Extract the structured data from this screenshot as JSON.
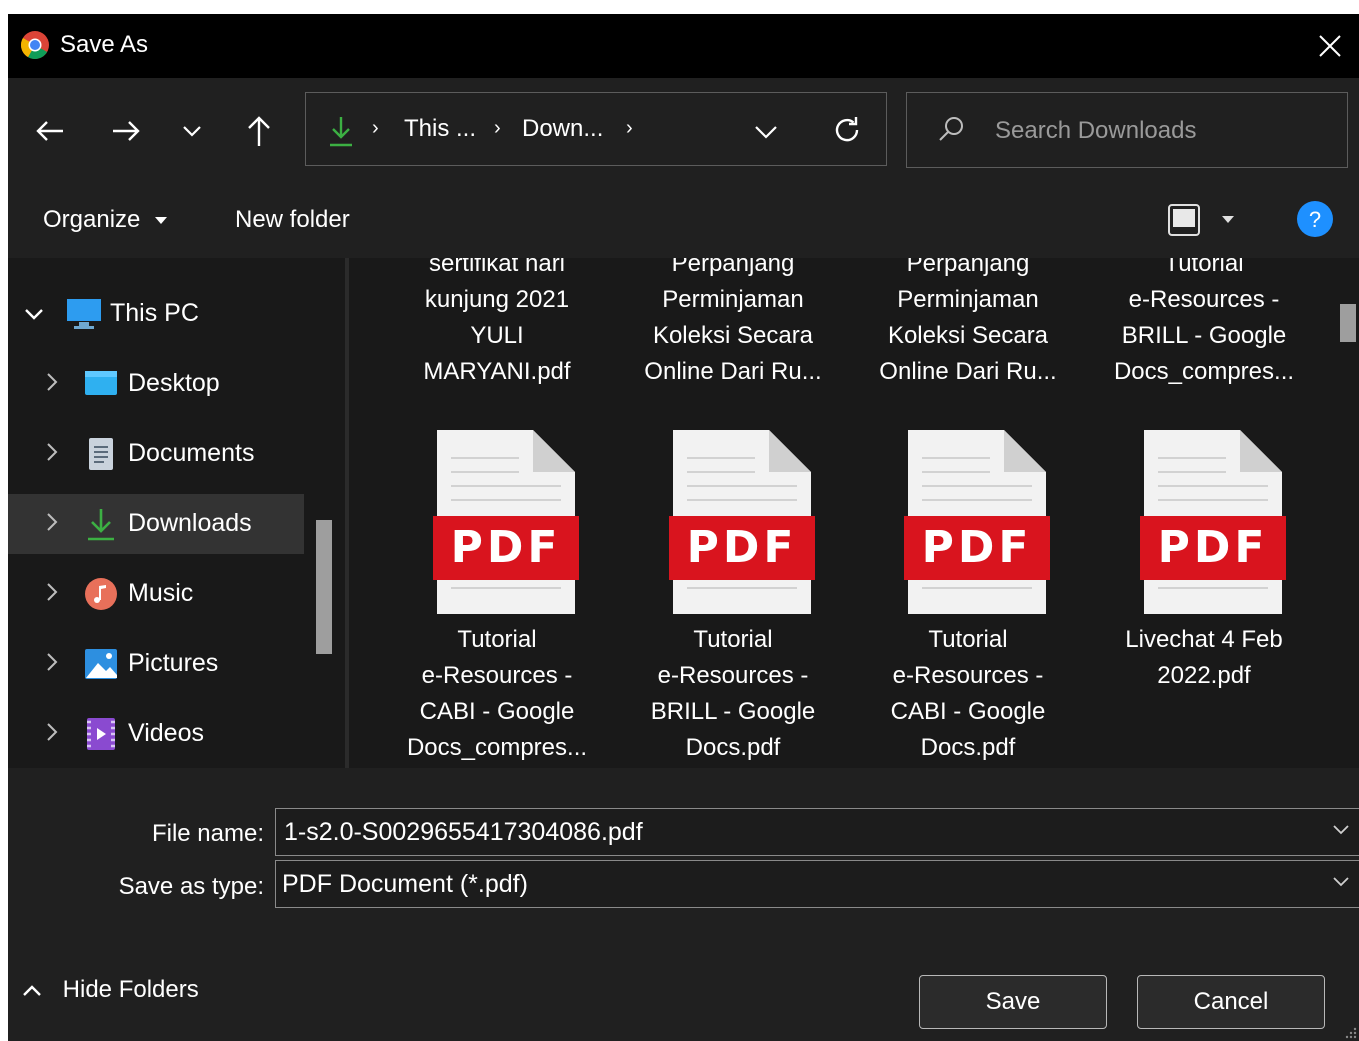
{
  "dialog": {
    "title": "Save As"
  },
  "nav": {
    "back_icon": "arrow-left-icon",
    "forward_icon": "arrow-right-icon",
    "recent_icon": "chevron-down-icon",
    "up_icon": "arrow-up-icon",
    "breadcrumb": [
      "This ...",
      "Down..."
    ],
    "search_placeholder": "Search Downloads"
  },
  "toolbar": {
    "organize_label": "Organize",
    "new_folder_label": "New folder"
  },
  "sidebar": {
    "items": [
      {
        "label": "This PC",
        "icon": "monitor-icon",
        "expanded": true
      },
      {
        "label": "Desktop",
        "icon": "desktop-folder-icon"
      },
      {
        "label": "Documents",
        "icon": "documents-icon"
      },
      {
        "label": "Downloads",
        "icon": "download-icon",
        "selected": true
      },
      {
        "label": "Music",
        "icon": "music-icon"
      },
      {
        "label": "Pictures",
        "icon": "pictures-icon"
      },
      {
        "label": "Videos",
        "icon": "videos-icon"
      }
    ]
  },
  "files": {
    "top_row": [
      {
        "lines": [
          "sertifikat hari",
          "kunjung 2021",
          "YULI",
          "MARYANI.pdf"
        ]
      },
      {
        "lines": [
          "Perpanjang",
          "Perminjaman",
          "Koleksi Secara",
          "Online Dari Ru..."
        ]
      },
      {
        "lines": [
          "Perpanjang",
          "Perminjaman",
          "Koleksi Secara",
          "Online Dari Ru..."
        ]
      },
      {
        "lines": [
          "Tutorial",
          "e-Resources -",
          "BRILL - Google",
          "Docs_compres..."
        ]
      }
    ],
    "bottom_row": [
      {
        "badge": "PDF",
        "lines": [
          "Tutorial",
          "e-Resources -",
          "CABI - Google",
          "Docs_compres..."
        ]
      },
      {
        "badge": "PDF",
        "lines": [
          "Tutorial",
          "e-Resources -",
          "BRILL - Google",
          "Docs.pdf"
        ]
      },
      {
        "badge": "PDF",
        "lines": [
          "Tutorial",
          "e-Resources -",
          "CABI - Google",
          "Docs.pdf"
        ]
      },
      {
        "badge": "PDF",
        "lines": [
          "Livechat 4 Feb",
          "2022.pdf"
        ]
      }
    ]
  },
  "form": {
    "file_name_label": "File name:",
    "file_name_value": "1-s2.0-S0029655417304086.pdf",
    "save_type_label": "Save as type:",
    "save_type_value": "PDF Document (*.pdf)"
  },
  "buttons": {
    "hide_folders": "Hide Folders",
    "save": "Save",
    "cancel": "Cancel"
  },
  "colors": {
    "pdf_red": "#d9141e",
    "accent_blue": "#1e90ff",
    "download_green": "#3cb043"
  }
}
